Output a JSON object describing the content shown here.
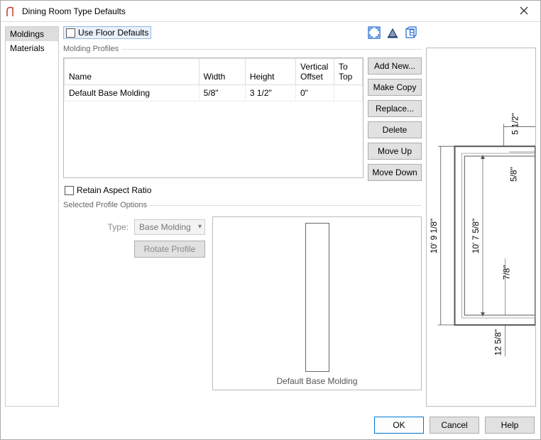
{
  "window": {
    "title": "Dining Room Type Defaults"
  },
  "nav": {
    "items": [
      {
        "label": "Moldings",
        "selected": true
      },
      {
        "label": "Materials",
        "selected": false
      }
    ]
  },
  "checkboxes": {
    "use_floor_defaults": "Use Floor Defaults",
    "retain_aspect_ratio": "Retain Aspect Ratio"
  },
  "molding_profiles": {
    "group_label": "Molding Profiles",
    "headers": {
      "name": "Name",
      "width": "Width",
      "height": "Height",
      "vertical_offset": "Vertical Offset",
      "to_top": "To Top"
    },
    "rows": [
      {
        "name": "Default Base Molding",
        "width": "5/8\"",
        "height": "3 1/2\"",
        "vertical_offset": "0\"",
        "to_top": ""
      }
    ],
    "buttons": {
      "add_new": "Add New...",
      "make_copy": "Make Copy",
      "replace": "Replace...",
      "delete": "Delete",
      "move_up": "Move Up",
      "move_down": "Move Down"
    }
  },
  "selected_profile": {
    "group_label": "Selected Profile Options",
    "type_label": "Type:",
    "type_value": "Base Molding",
    "rotate_button": "Rotate Profile",
    "preview_label": "Default Base Molding"
  },
  "preview_dims": {
    "a": "5 1/2\"",
    "b": "5/8\"",
    "c": "10' 9 1/8\"",
    "d": "10' 7 5/8\"",
    "e": "7/8\"",
    "f": "12 5/8\""
  },
  "footer": {
    "ok": "OK",
    "cancel": "Cancel",
    "help": "Help"
  },
  "toolbar_icons": {
    "expand": "expand-icon",
    "color": "color-toggle-icon",
    "view": "elevation-view-icon"
  }
}
